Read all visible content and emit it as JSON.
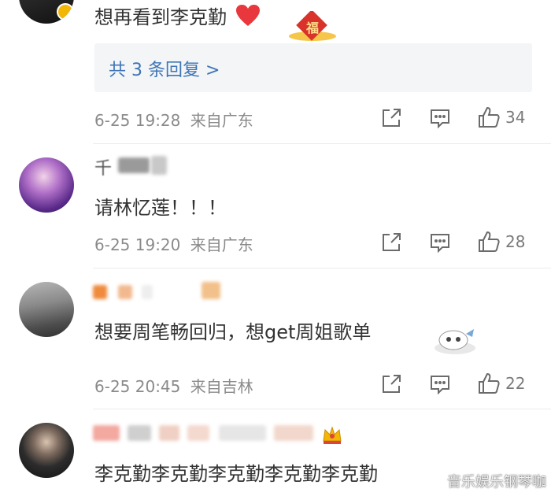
{
  "comments": [
    {
      "text": "想再看到李克勤",
      "time": "6-25 19:28",
      "location": "来自广东",
      "likes": "34",
      "reply_link": "共 3 条回复 >"
    },
    {
      "username_partial": "千",
      "text": "请林忆莲！！！",
      "time": "6-25 19:20",
      "location": "来自广东",
      "likes": "28"
    },
    {
      "text": "想要周笔畅回归，想get周姐歌单",
      "time": "6-25 20:45",
      "location": "来自吉林",
      "likes": "22"
    },
    {
      "text": "李克勤李克勤李克勤李克勤李克勤"
    }
  ],
  "badge_glyph": "福",
  "watermark": "音乐娱乐钢琴咖",
  "colors": {
    "link": "#3e74b6",
    "meta": "#8a8a8a",
    "reply_bg": "#f3f5f7",
    "heart": "#e8383d",
    "verified": "#f2b705"
  },
  "icons": [
    "share-icon",
    "comment-icon",
    "like-icon",
    "heart-emoji",
    "crown-badge-icon",
    "weibo-logo-icon"
  ]
}
